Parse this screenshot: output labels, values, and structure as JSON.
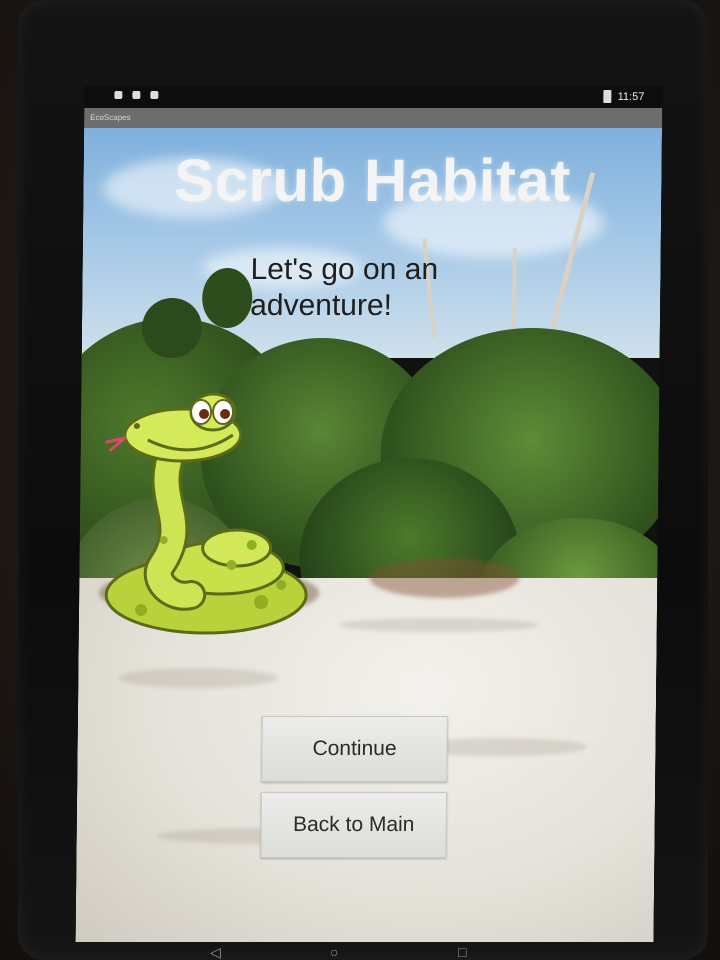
{
  "status_bar": {
    "time": "11:57"
  },
  "app": {
    "title": "EcoScapes"
  },
  "screen": {
    "title": "Scrub Habitat",
    "subtitle": "Let's go on an adventure!",
    "mascot": "snake-mascot"
  },
  "buttons": {
    "continue_label": "Continue",
    "back_label": "Back to Main"
  },
  "nav_icons": [
    "back-icon",
    "home-icon",
    "recents-icon"
  ],
  "colors": {
    "title_text": "#f4f4f4",
    "button_bg": "#e4e4e1",
    "snake_body": "#c8e04a"
  }
}
